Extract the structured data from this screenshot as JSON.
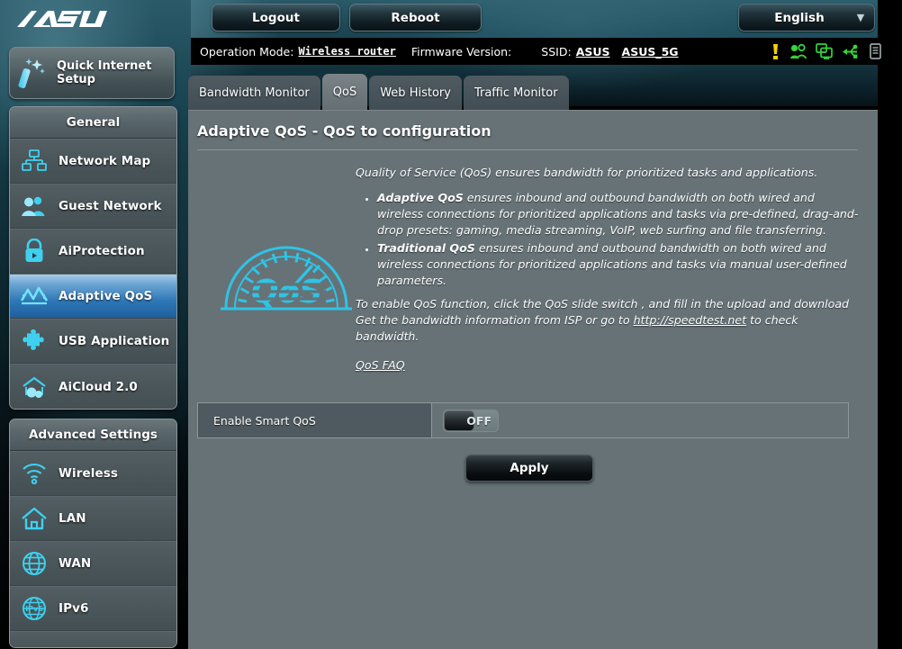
{
  "brand": {
    "logo_text": "/ISUS"
  },
  "header": {
    "logout_label": "Logout",
    "reboot_label": "Reboot",
    "language_label": "English",
    "caret_icon": "chevron-down-icon"
  },
  "statusbar": {
    "operation_mode_label": "Operation Mode:",
    "operation_mode_value": "Wireless router",
    "firmware_label": "Firmware Version:",
    "firmware_value": "",
    "ssid_label": "SSID:",
    "ssid_values": [
      "ASUS",
      "ASUS_5G"
    ],
    "icons": [
      {
        "name": "alert-icon",
        "color": "#f2d00a"
      },
      {
        "name": "clients-icon",
        "color": "#34d43a"
      },
      {
        "name": "devices-icon",
        "color": "#34d43a"
      },
      {
        "name": "usb-icon",
        "color": "#34d43a"
      },
      {
        "name": "printer-icon",
        "color": "#9aa3a6"
      }
    ]
  },
  "quick_setup": {
    "label": "Quick Internet\nSetup",
    "icon": "magic-wand-icon"
  },
  "sidebar": {
    "groups": [
      {
        "title": "General",
        "items": [
          {
            "label": "Network Map",
            "icon": "network-map-icon",
            "active": false
          },
          {
            "label": "Guest Network",
            "icon": "guest-network-icon",
            "active": false
          },
          {
            "label": "AiProtection",
            "icon": "shield-lock-icon",
            "active": false
          },
          {
            "label": "Adaptive QoS",
            "icon": "qos-wave-icon",
            "active": true
          },
          {
            "label": "USB Application",
            "icon": "puzzle-piece-icon",
            "active": false
          },
          {
            "label": "AiCloud 2.0",
            "icon": "cloud-house-icon",
            "active": false
          }
        ]
      },
      {
        "title": "Advanced Settings",
        "items": [
          {
            "label": "Wireless",
            "icon": "wifi-icon",
            "active": false
          },
          {
            "label": "LAN",
            "icon": "home-icon",
            "active": false
          },
          {
            "label": "WAN",
            "icon": "globe-icon",
            "active": false
          },
          {
            "label": "IPv6",
            "icon": "ipv6-globe-icon",
            "active": false
          }
        ]
      }
    ]
  },
  "tabs": [
    {
      "label": "Bandwidth Monitor",
      "active": false
    },
    {
      "label": "QoS",
      "active": true
    },
    {
      "label": "Web History",
      "active": false
    },
    {
      "label": "Traffic Monitor",
      "active": false
    }
  ],
  "main": {
    "page_title": "Adaptive QoS - QoS to configuration",
    "intro": "Quality of Service (QoS) ensures bandwidth for prioritized tasks and applications.",
    "bullets": [
      {
        "term": "Adaptive QoS",
        "text": " ensures inbound and outbound bandwidth on both wired and wireless connections for prioritized applications and tasks via pre-defined, drag-and-drop presets: gaming, media streaming, VoIP, web surfing and file transferring."
      },
      {
        "term": "Traditional QoS",
        "text": " ensures inbound and outbound bandwidth on both wired and wireless connections for prioritized applications and tasks via manual user-defined parameters."
      }
    ],
    "enable_text_before": "To enable QoS function, click the QoS slide switch , and fill in the upload and download Get the bandwidth information from ISP or go to ",
    "enable_link": "http://speedtest.net",
    "enable_text_after": " to check bandwidth.",
    "faq_link": "QoS FAQ",
    "logo_icon": "qos-speedometer-icon",
    "logo_text": "QoS"
  },
  "settings": {
    "enable_smart_qos_label": "Enable Smart QoS",
    "toggle_state": "OFF",
    "apply_label": "Apply"
  },
  "colors": {
    "accent_blue": "#2f78b7",
    "panel_bg": "#667276",
    "sidebar_bg": "#4a5659",
    "icon_cyan": "#2ec4e6",
    "alert_yellow": "#f2d00a",
    "status_green": "#34d43a"
  }
}
